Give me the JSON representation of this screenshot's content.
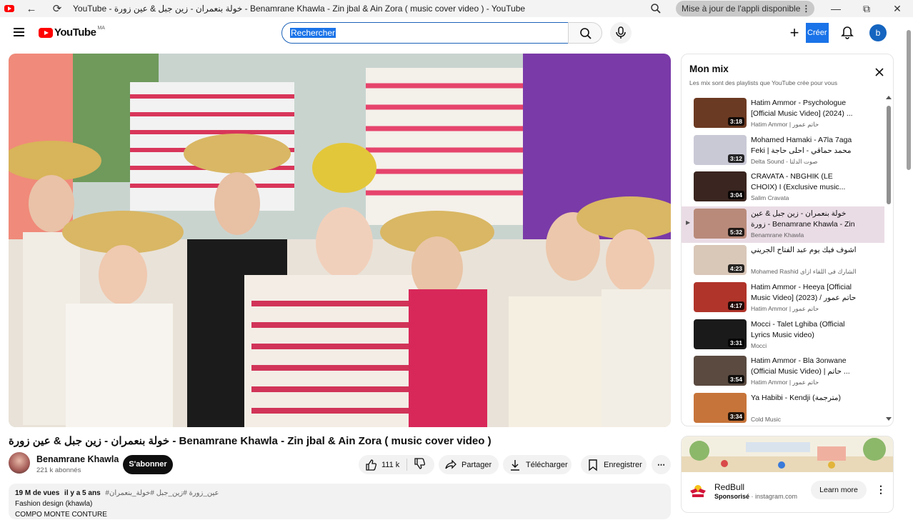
{
  "window": {
    "title": "YouTube - خولة بنعمران - زين جبل & عين زورة - Benamrane Khawla - Zin jbal & Ain Zora ( music cover video ) - YouTube",
    "update_pill": "Mise à jour de l'appli disponible",
    "controls": {
      "minimize": "—",
      "maximize": "⧉",
      "close": "✕"
    }
  },
  "header": {
    "logo_text": "YouTube",
    "country_code": "MA",
    "search": {
      "value": "Rechercher"
    },
    "create_label": "Créer",
    "avatar_letter": "b"
  },
  "video": {
    "title": "خولة بنعمران - زين جبل & عين زورة - Benamrane Khawla - Zin jbal & Ain Zora ( music cover video )",
    "channel": "Benamrane Khawla",
    "subscribers": "221 k abonnés",
    "subscribe_label": "S'abonner",
    "likes": "111 k",
    "share_label": "Partager",
    "download_label": "Télécharger",
    "save_label": "Enregistrer",
    "views": "19 M de vues",
    "age": "il y a 5 ans",
    "hashtags": "#عين_زورة #زين_جبل #خولة_بنعمران",
    "desc_line1": "Fashion design (khawla)",
    "desc_line2": "COMPO  MONTE  CONTURE"
  },
  "mix": {
    "title": "Mon mix",
    "subtitle": "Les mix sont des playlists que YouTube crée pour vous",
    "items": [
      {
        "title": "Hatim Ammor - Psychologue [Official Music Video] (2024) ...",
        "channel": "Hatim Ammor | حاتم عمور",
        "duration": "3:18",
        "thumb_color": "#6b3a22",
        "active": false
      },
      {
        "title": "Mohamed Hamaki - A7la 7aga Feki | محمد حماقي - احلى حاجة فيكي",
        "channel": "Delta Sound - صوت الدلتا",
        "duration": "3:12",
        "thumb_color": "#c9c9d6",
        "active": false
      },
      {
        "title": "CRAVATA - NBGHIK (LE CHOIX) I (Exclusive music...",
        "channel": "Salim Cravata",
        "duration": "3:04",
        "thumb_color": "#3a2520",
        "active": false
      },
      {
        "title": "خولة بنعمران - زين جبل & عين زورة - Benamrane Khawla - Zin jbal ...",
        "channel": "Benamrane Khawla",
        "duration": "5:32",
        "thumb_color": "#b98a7a",
        "active": true
      },
      {
        "title": "اشوف فيك يوم عبد الفتاح الجريني",
        "channel": "Mohamed Rashid الشارك فى اللقاء ازاى",
        "duration": "4:23",
        "thumb_color": "#d9c7b8",
        "active": false
      },
      {
        "title": "Hatim Ammor - Heeya [Official Music Video] (2023) / حاتم عمور ...",
        "channel": "Hatim Ammor | حاتم عمور",
        "duration": "4:17",
        "thumb_color": "#b0342a",
        "active": false
      },
      {
        "title": "Mocci - Talet Lghiba (Official Lyrics Music video)",
        "channel": "Mocci",
        "duration": "3:31",
        "thumb_color": "#1a1a1a",
        "active": false
      },
      {
        "title": "Hatim Ammor - Bla 3onwane (Official Music Video) | حاتم ...",
        "channel": "Hatim Ammor | حاتم عمور",
        "duration": "3:54",
        "thumb_color": "#5a4a40",
        "active": false
      },
      {
        "title": "Ya Habibi - Kendji (مترجمة)",
        "channel": "Cold Music",
        "duration": "3:34",
        "thumb_color": "#c7743a",
        "active": false
      }
    ]
  },
  "ad": {
    "advertiser": "RedBull",
    "sponsored": "Sponsorisé",
    "domain": "instagram.com",
    "cta": "Learn more"
  }
}
